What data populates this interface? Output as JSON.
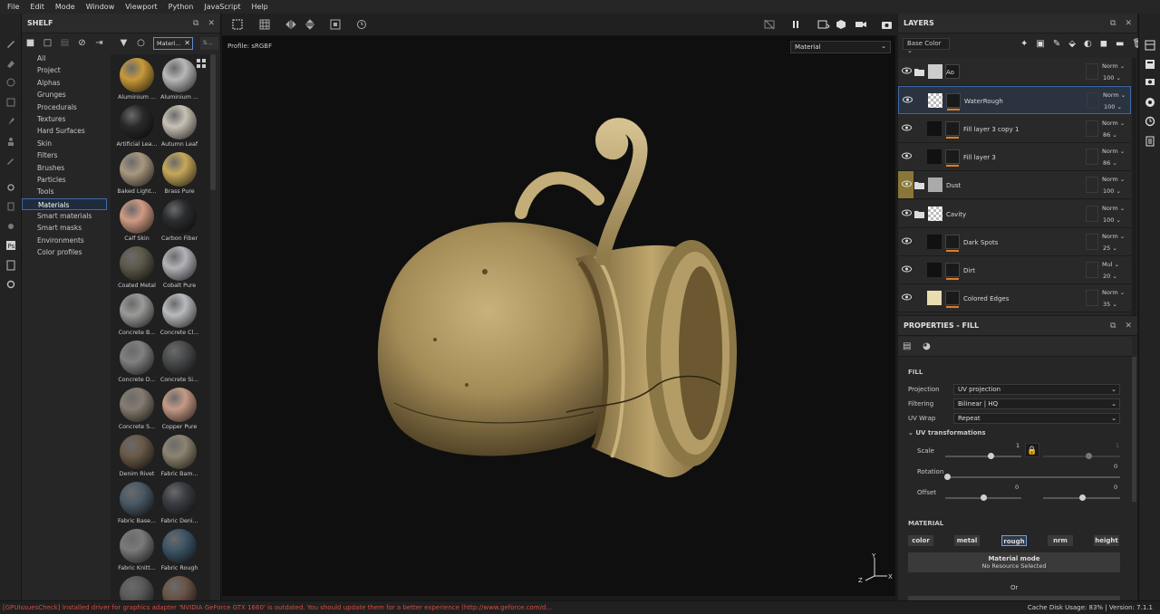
{
  "menu": [
    "File",
    "Edit",
    "Mode",
    "Window",
    "Viewport",
    "Python",
    "JavaScript",
    "Help"
  ],
  "shelf": {
    "title": "SHELF",
    "search_value": "Materi...",
    "tab2": "S...",
    "categories": [
      "All",
      "Project",
      "Alphas",
      "Grunges",
      "Procedurals",
      "Textures",
      "Hard Surfaces",
      "Skin",
      "Filters",
      "Brushes",
      "Particles",
      "Tools",
      "Materials",
      "Smart materials",
      "Smart masks",
      "Environments",
      "Color profiles"
    ],
    "selected_category": "Materials",
    "materials": [
      {
        "label": "Aluminium ...",
        "color": "#c89a3a"
      },
      {
        "label": "Aluminium ...",
        "color": "#b8b8b8"
      },
      {
        "label": "Artificial Lea...",
        "color": "#2a2a2a"
      },
      {
        "label": "Autumn Leaf",
        "color": "#c8c2b5"
      },
      {
        "label": "Baked Light...",
        "color": "#a89880"
      },
      {
        "label": "Brass Pure",
        "color": "#c6a85a"
      },
      {
        "label": "Calf Skin",
        "color": "#d09a84"
      },
      {
        "label": "Carbon Fiber",
        "color": "#2b2d30"
      },
      {
        "label": "Coated Metal",
        "color": "#5d5a4a"
      },
      {
        "label": "Cobalt Pure",
        "color": "#b2b2b8"
      },
      {
        "label": "Concrete B...",
        "color": "#9a9a98"
      },
      {
        "label": "Concrete Cl...",
        "color": "#b8bbbe"
      },
      {
        "label": "Concrete D...",
        "color": "#808080"
      },
      {
        "label": "Concrete Si...",
        "color": "#4a4b4c"
      },
      {
        "label": "Concrete S...",
        "color": "#857c70"
      },
      {
        "label": "Copper Pure",
        "color": "#c59a86"
      },
      {
        "label": "Denim Rivet",
        "color": "#6a5a48"
      },
      {
        "label": "Fabric Bam...",
        "color": "#8c8470"
      },
      {
        "label": "Fabric Base...",
        "color": "#4a5a66"
      },
      {
        "label": "Fabric Deni...",
        "color": "#3a3d42"
      },
      {
        "label": "Fabric Knitt...",
        "color": "#7a7a7a"
      },
      {
        "label": "Fabric Rough",
        "color": "#3e5566"
      },
      {
        "label": "",
        "color": "#5a5a5a"
      },
      {
        "label": "",
        "color": "#6a5548"
      }
    ]
  },
  "viewport": {
    "profile": "Profile: sRGBF",
    "mode_select": "Material"
  },
  "layers": {
    "title": "LAYERS",
    "channel_select": "Base Color",
    "items": [
      {
        "name": "Ao",
        "blend": "Norm",
        "opacity": "100",
        "folder": true,
        "selected": false,
        "highlight": false
      },
      {
        "name": "WaterRough",
        "blend": "Norm",
        "opacity": "100",
        "folder": false,
        "selected": true,
        "highlight": false
      },
      {
        "name": "Fill layer 3 copy 1",
        "blend": "Norm",
        "opacity": "86",
        "folder": false,
        "selected": false,
        "highlight": false
      },
      {
        "name": "Fill layer 3",
        "blend": "Norm",
        "opacity": "86",
        "folder": false,
        "selected": false,
        "highlight": false
      },
      {
        "name": "Dust",
        "blend": "Norm",
        "opacity": "100",
        "folder": true,
        "selected": false,
        "highlight": true
      },
      {
        "name": "Cavity",
        "blend": "Norm",
        "opacity": "100",
        "folder": true,
        "selected": false,
        "highlight": false
      },
      {
        "name": "Dark Spots",
        "blend": "Norm",
        "opacity": "25",
        "folder": false,
        "selected": false,
        "highlight": false
      },
      {
        "name": "Dirt",
        "blend": "Mul",
        "opacity": "20",
        "folder": false,
        "selected": false,
        "highlight": false
      },
      {
        "name": "Colored Edges",
        "blend": "Norm",
        "opacity": "35",
        "folder": false,
        "selected": false,
        "highlight": false
      }
    ]
  },
  "properties": {
    "title": "PROPERTIES - FILL",
    "fill_heading": "FILL",
    "projection_label": "Projection",
    "projection_value": "UV projection",
    "filtering_label": "Filtering",
    "filtering_value": "Bilinear | HQ",
    "uvwrap_label": "UV Wrap",
    "uvwrap_value": "Repeat",
    "uv_transform": "UV transformations",
    "scale_label": "Scale",
    "scale_value": "1",
    "scale_value2": "1",
    "rotation_label": "Rotation",
    "rotation_value": "0",
    "offset_label": "Offset",
    "offset_value": "0",
    "offset_value2": "0",
    "material_heading": "MATERIAL",
    "channels": [
      "color",
      "metal",
      "rough",
      "nrm",
      "height"
    ],
    "selected_channel": "rough",
    "material_mode": "Material mode",
    "no_resource": "No Resource Selected",
    "or_text": "Or"
  },
  "status": {
    "error": "[GPUIssuesCheck] Installed driver for graphics adapter 'NVIDIA GeForce GTX 1660' is outdated. You should update them for a better experience (http://www.geforce.com/d...",
    "cache": "Cache Disk Usage:   83% | Version: 7.1.1"
  }
}
